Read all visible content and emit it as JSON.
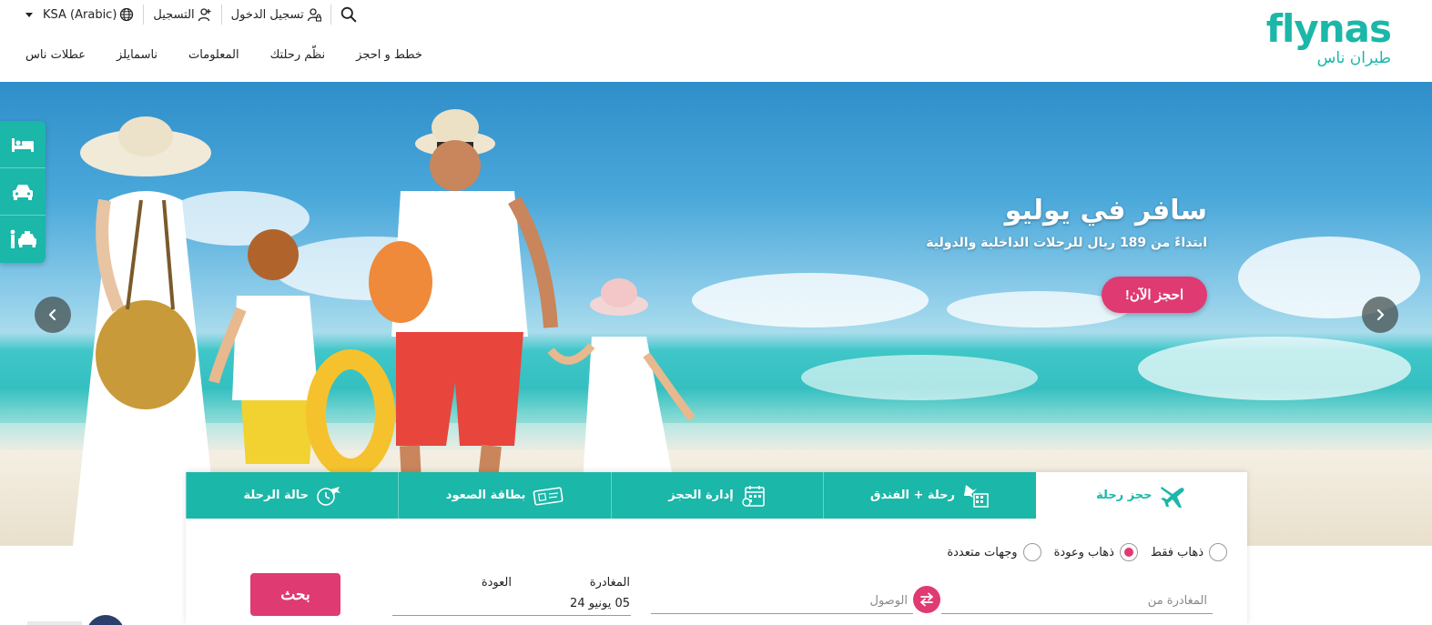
{
  "brand": {
    "logo_en": "flynas",
    "logo_ar": "طيران ناس",
    "teal": "#1bb7a8",
    "pink": "#e03a73"
  },
  "top_bar": {
    "search_icon": "search-icon",
    "login_label": "تسجيل الدخول",
    "register_label": "التسجيل",
    "locale_label": "KSA (Arabic)",
    "globe_icon": "globe-icon"
  },
  "nav": {
    "items": [
      "عطلات ناس",
      "ناسمايلز",
      "المعلومات",
      "نظّم رحلتك",
      "خطط و احجز"
    ]
  },
  "hero": {
    "title": "سافر في يوليو",
    "subtitle": "ابتداءً من 189 ريال للرحلات الداخلية والدولية",
    "cta_label": "احجز الآن!"
  },
  "side_rail": {
    "items": [
      "hotel-icon",
      "car-icon",
      "transfer-icon"
    ]
  },
  "booking": {
    "tabs": [
      {
        "label": "حالة الرحلة",
        "icon": "flight-status-icon",
        "active": false
      },
      {
        "label": "بطاقة الصعود",
        "icon": "boarding-pass-icon",
        "active": false
      },
      {
        "label": "إدارة الحجز",
        "icon": "manage-booking-icon",
        "active": false
      },
      {
        "label": "رحلة + الفندق",
        "icon": "flight-hotel-icon",
        "active": false
      },
      {
        "label": "حجز رحلة",
        "icon": "plane-icon",
        "active": true
      }
    ],
    "trip_types": [
      {
        "label": "ذهاب فقط",
        "checked": false
      },
      {
        "label": "ذهاب وعودة",
        "checked": true
      },
      {
        "label": "وجهات متعددة",
        "checked": false
      }
    ],
    "origin_placeholder": "المغادرة من",
    "destination_placeholder": "الوصول",
    "departure_label": "المغادرة",
    "departure_value": "05 يونيو 24",
    "return_label": "العودة",
    "search_label": "بحث"
  }
}
